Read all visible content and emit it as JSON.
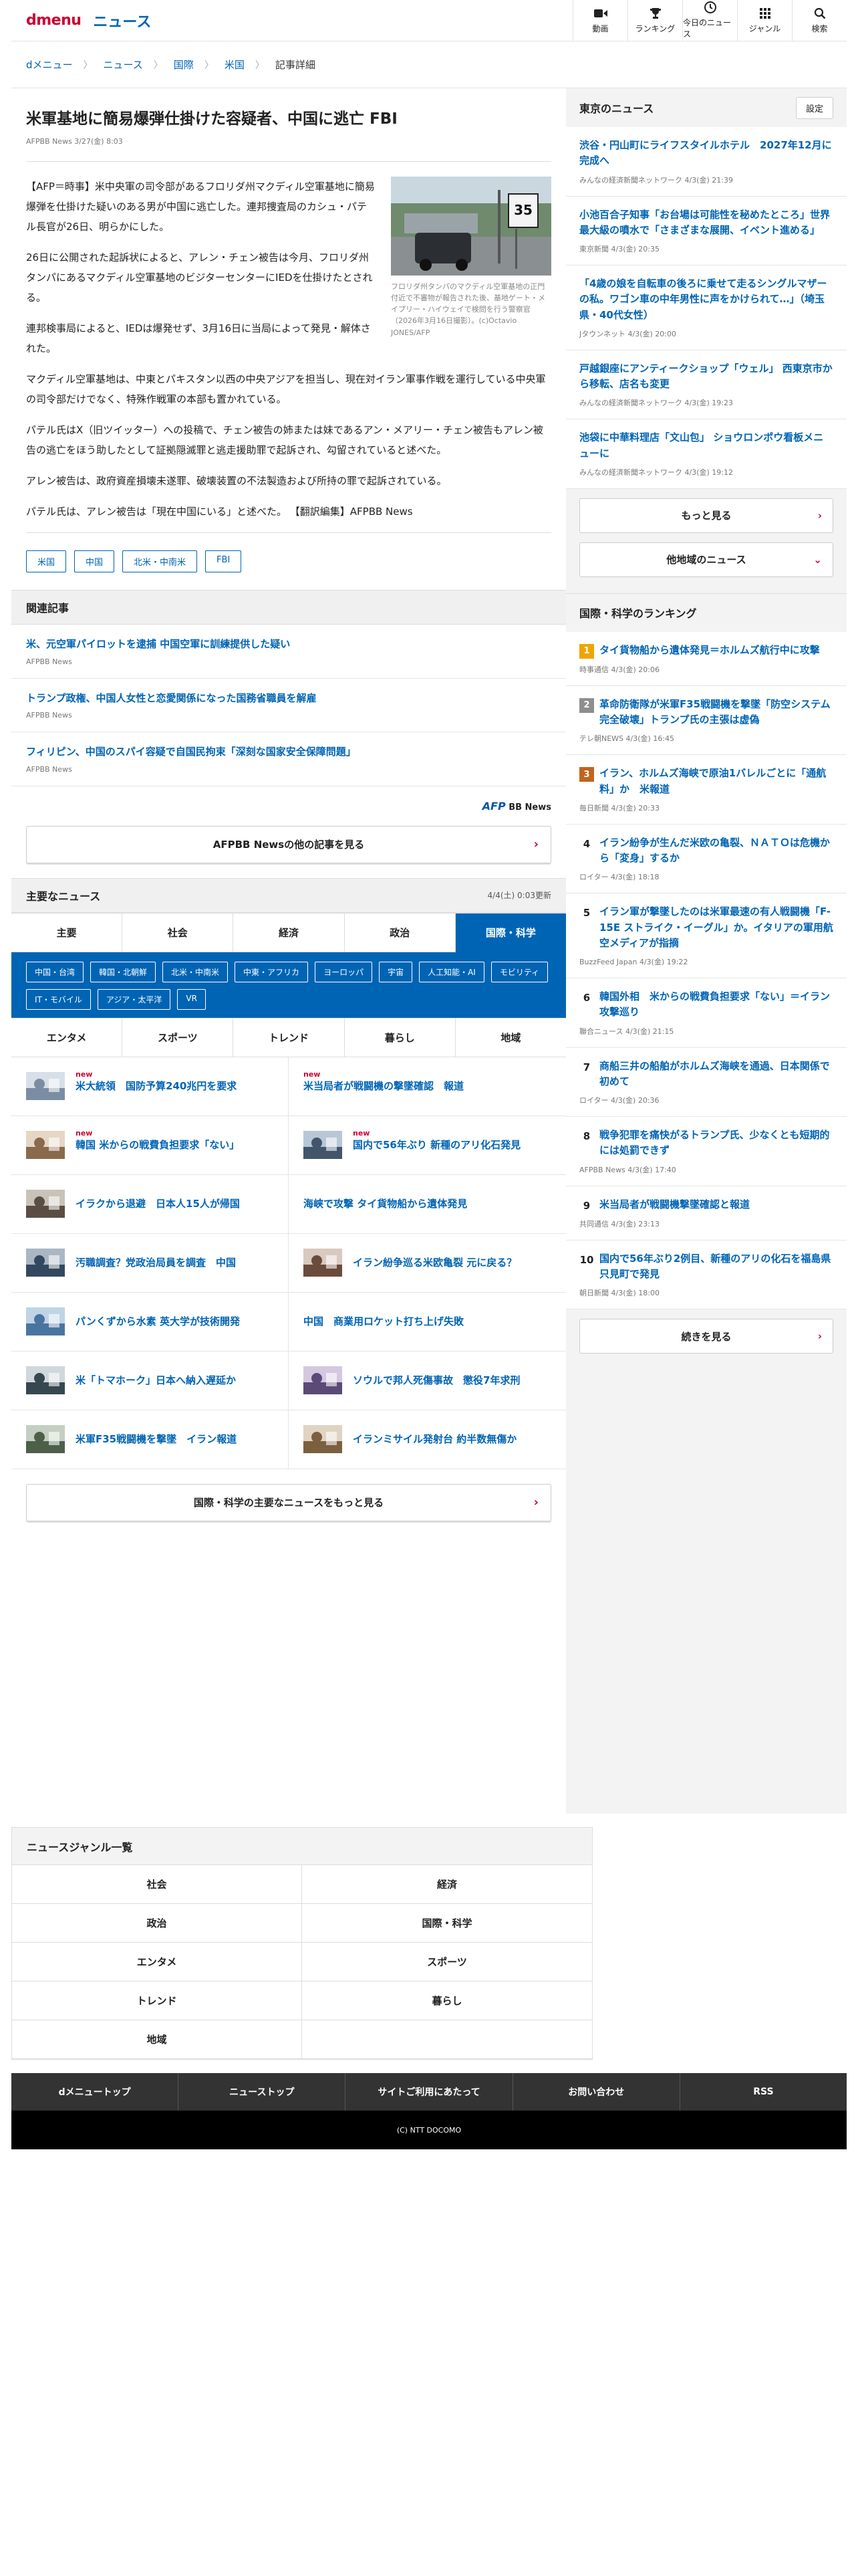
{
  "header": {
    "logo_d": "dmenu",
    "logo_news": "ニュース",
    "nav": [
      {
        "label": "動画",
        "icon": "video-icon"
      },
      {
        "label": "ランキング",
        "icon": "trophy-icon"
      },
      {
        "label": "今日のニュース",
        "icon": "clock-icon"
      },
      {
        "label": "ジャンル",
        "icon": "grid-icon"
      },
      {
        "label": "検索",
        "icon": "search-icon"
      }
    ]
  },
  "breadcrumb": [
    "dメニュー",
    "ニュース",
    "国際",
    "米国",
    "記事詳細"
  ],
  "article": {
    "title": "米軍基地に簡易爆弾仕掛けた容疑者、中国に逃亡 FBI",
    "meta": "AFPBB News 3/27(金) 8:03",
    "caption": "フロリダ州タンパのマクディル空軍基地の正門付近で不審物が報告された後、基地ゲート・メイプリー・ハイウェイで検問を行う警察官（2026年3月16日撮影）。(c)Octavio JONES/AFP",
    "paragraphs": [
      "【AFP＝時事】米中央軍の司令部があるフロリダ州マクディル空軍基地に簡易爆弾を仕掛けた疑いのある男が中国に逃亡した。連邦捜査局のカシュ・パテル長官が26日、明らかにした。",
      "26日に公開された起訴状によると、アレン・チェン被告は今月、フロリダ州タンパにあるマクディル空軍基地のビジターセンターにIEDを仕掛けたとされる。",
      "連邦検事局によると、IEDは爆発せず、3月16日に当局によって発見・解体された。",
      "マクディル空軍基地は、中東とパキスタン以西の中央アジアを担当し、現在対イラン軍事作戦を運行している中央軍の司令部だけでなく、特殊作戦軍の本部も置かれている。",
      "パテル氏はX（旧ツイッター）への投稿で、チェン被告の姉または妹であるアン・メアリー・チェン被告もアレン被告の逃亡をほう助したとして証拠隠滅罪と逃走援助罪で起訴され、勾留されていると述べた。",
      "アレン被告は、政府資産損壊未遂罪、破壊装置の不法製造および所持の罪で起訴されている。",
      "パテル氏は、アレン被告は「現在中国にいる」と述べた。 【翻訳編集】AFPBB News"
    ],
    "sign_text": "35",
    "tags": [
      "米国",
      "中国",
      "北米・中南米",
      "FBI"
    ]
  },
  "related": {
    "heading": "関連記事",
    "items": [
      {
        "title": "米、元空軍パイロットを逮捕 中国空軍に訓練提供した疑い",
        "src": "AFPBB News"
      },
      {
        "title": "トランプ政権、中国人女性と恋愛関係になった国務省職員を解雇",
        "src": "AFPBB News"
      },
      {
        "title": "フィリピン、中国のスパイ容疑で自国民拘束「深刻な国家安全保障問題」",
        "src": "AFPBB News"
      }
    ],
    "logo_afp": "AFP",
    "logo_bb": "BB News",
    "more": "AFPBB Newsの他の記事を見る"
  },
  "major": {
    "heading": "主要なニュース",
    "updated": "4/4(土) 0:03更新",
    "tabs": [
      "主要",
      "社会",
      "経済",
      "政治",
      "国際・科学"
    ],
    "subtabs": [
      "中国・台湾",
      "韓国・北朝鮮",
      "北米・中南米",
      "中東・アフリカ",
      "ヨーロッパ",
      "宇宙",
      "人工知能・AI",
      "モビリティ",
      "IT・モバイル",
      "アジア・太平洋",
      "VR"
    ],
    "tabs2": [
      "エンタメ",
      "スポーツ",
      "トレンド",
      "暮らし",
      "地域"
    ],
    "new_label": "new",
    "news": [
      {
        "title": "米大統領　国防予算240兆円を要求",
        "new": true,
        "thumb": true
      },
      {
        "title": "米当局者が戦闘機の撃墜確認　報道",
        "new": true,
        "thumb": false
      },
      {
        "title": "韓国 米からの戦費負担要求「ない」",
        "new": true,
        "thumb": true
      },
      {
        "title": "国内で56年ぶり 新種のアリ化石発見",
        "new": true,
        "thumb": true
      },
      {
        "title": "イラクから退避　日本人15人が帰国",
        "new": false,
        "thumb": true
      },
      {
        "title": "海峡で攻撃 タイ貨物船から遺体発見",
        "new": false,
        "thumb": false
      },
      {
        "title": "汚職調査？党政治局員を調査　中国",
        "new": false,
        "thumb": true
      },
      {
        "title": "イラン紛争巡る米欧亀裂 元に戻る？",
        "new": false,
        "thumb": true
      },
      {
        "title": "パンくずから水素 英大学が技術開発",
        "new": false,
        "thumb": true
      },
      {
        "title": "中国　商業用ロケット打ち上げ失敗",
        "new": false,
        "thumb": false
      },
      {
        "title": "米「トマホーク」日本へ納入遅延か",
        "new": false,
        "thumb": true
      },
      {
        "title": "ソウルで邦人死傷事故　懲役7年求刑",
        "new": false,
        "thumb": true
      },
      {
        "title": "米軍F35戦闘機を撃墜　イラン報道",
        "new": false,
        "thumb": true
      },
      {
        "title": "イランミサイル発射台 約半数無傷か",
        "new": false,
        "thumb": true
      }
    ],
    "more": "国際・科学の主要なニュースをもっと見る"
  },
  "genre": {
    "heading": "ニュースジャンル一覧",
    "items": [
      "社会",
      "経済",
      "政治",
      "国際・科学",
      "エンタメ",
      "スポーツ",
      "トレンド",
      "暮らし",
      "地域"
    ]
  },
  "footer": {
    "nav": [
      "dメニュートップ",
      "ニューストップ",
      "サイトご利用にあたって",
      "お問い合わせ",
      "RSS"
    ],
    "copyright": "(C) NTT DOCOMO"
  },
  "side": {
    "tokyo_heading": "東京のニュース",
    "settings": "設定",
    "tokyo": [
      {
        "title": "渋谷・円山町にライフスタイルホテル　2027年12月に完成へ",
        "src": "みんなの経済新聞ネットワーク 4/3(金) 21:39"
      },
      {
        "title": "小池百合子知事「お台場は可能性を秘めたところ」世界最大級の噴水で「さまざまな展開、イベント進める」",
        "src": "東京新聞 4/3(金) 20:35"
      },
      {
        "title": "「4歳の娘を自転車の後ろに乗せて走るシングルマザーの私。ワゴン車の中年男性に声をかけられて…」（埼玉県・40代女性）",
        "src": "Jタウンネット 4/3(金) 20:00"
      },
      {
        "title": "戸越銀座にアンティークショップ「ウェル」 西東京市から移転、店名も変更",
        "src": "みんなの経済新聞ネットワーク 4/3(金) 19:23"
      },
      {
        "title": "池袋に中華料理店「文山包」 ショウロンポウ看板メニューに",
        "src": "みんなの経済新聞ネットワーク 4/3(金) 19:12"
      }
    ],
    "more": "もっと見る",
    "other_region": "他地域のニュース",
    "rank_heading": "国際・科学のランキング",
    "rank_colors": [
      "#f0a500",
      "#8e8e8e",
      "#c0641e"
    ],
    "ranking": [
      {
        "no": "1",
        "title": "タイ貨物船から遺体発見＝ホルムズ航行中に攻撃",
        "src": "時事通信 4/3(金) 20:06"
      },
      {
        "no": "2",
        "title": "革命防衛隊が米軍F35戦闘機を撃墜「防空システム完全破壊」トランプ氏の主張は虚偽",
        "src": "テレ朝NEWS 4/3(金) 16:45"
      },
      {
        "no": "3",
        "title": "イラン、ホルムズ海峡で原油1バレルごとに「通航料」か　米報道",
        "src": "毎日新聞 4/3(金) 20:33"
      },
      {
        "no": "4",
        "title": "イラン紛争が生んだ米欧の亀裂、ＮＡＴＯは危機から「変身」するか",
        "src": "ロイター 4/3(金) 18:18"
      },
      {
        "no": "5",
        "title": "イラン軍が撃墜したのは米軍最速の有人戦闘機「F-15E ストライク・イーグル」か。イタリアの軍用航空メディアが指摘",
        "src": "BuzzFeed Japan 4/3(金) 19:22"
      },
      {
        "no": "6",
        "title": "韓国外相　米からの戦費負担要求「ない」＝イラン攻撃巡り",
        "src": "聯合ニュース 4/3(金) 21:15"
      },
      {
        "no": "7",
        "title": "商船三井の船舶がホルムズ海峡を通過、日本関係で初めて",
        "src": "ロイター 4/3(金) 20:36"
      },
      {
        "no": "8",
        "title": "戦争犯罪を痛快がるトランプ氏、少なくとも短期的には処罰できず",
        "src": "AFPBB News 4/3(金) 17:40"
      },
      {
        "no": "9",
        "title": "米当局者が戦闘機撃墜確認と報道",
        "src": "共同通信 4/3(金) 23:13"
      },
      {
        "no": "10",
        "title": "国内で56年ぶり2例目、新種のアリの化石を福島県只見町で発見",
        "src": "朝日新聞 4/3(金) 18:00"
      }
    ],
    "rank_more": "続きを見る"
  }
}
